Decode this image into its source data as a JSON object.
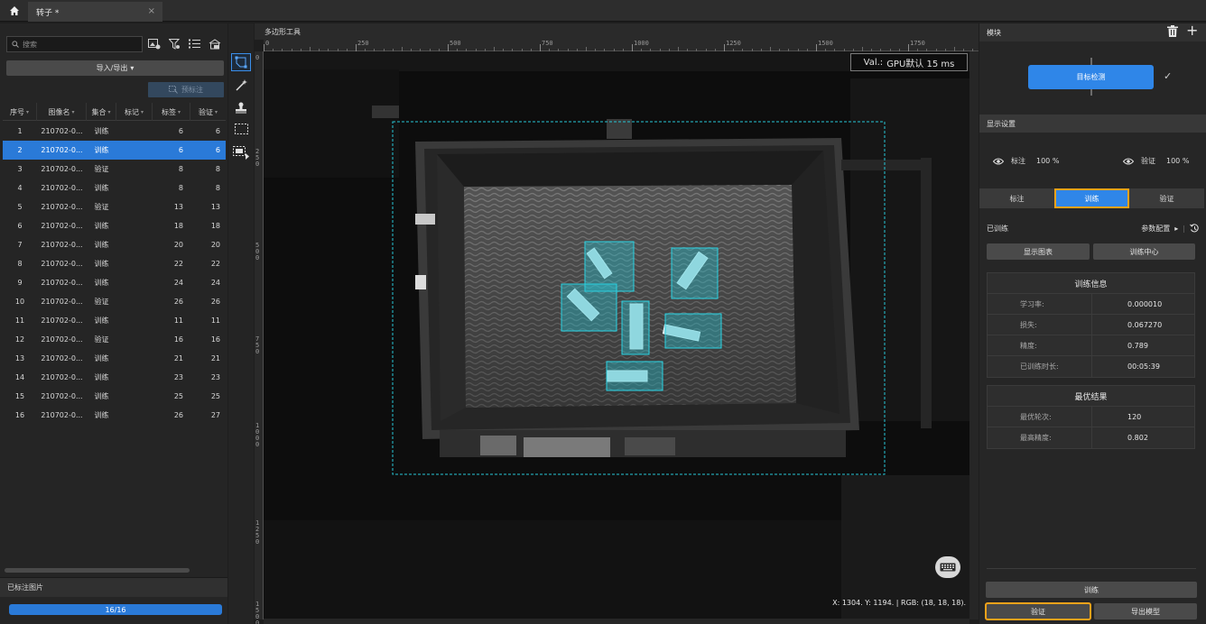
{
  "titlebar": {
    "tab_name": "转子 *",
    "tab_close": "×"
  },
  "left": {
    "search_placeholder": "搜索",
    "io_button": "导入/导出",
    "io_caret": "▾",
    "prelabel_button": "预标注",
    "columns": [
      "序号",
      "图像名",
      "集合",
      "标记",
      "标签",
      "验证"
    ],
    "rows": [
      {
        "idx": "1",
        "name": "210702-0...",
        "set": "训练",
        "label": "6",
        "val": "6",
        "selected": false
      },
      {
        "idx": "2",
        "name": "210702-0...",
        "set": "训练",
        "label": "6",
        "val": "6",
        "selected": true
      },
      {
        "idx": "3",
        "name": "210702-0...",
        "set": "验证",
        "label": "8",
        "val": "8",
        "selected": false
      },
      {
        "idx": "4",
        "name": "210702-0...",
        "set": "训练",
        "label": "8",
        "val": "8",
        "selected": false
      },
      {
        "idx": "5",
        "name": "210702-0...",
        "set": "验证",
        "label": "13",
        "val": "13",
        "selected": false
      },
      {
        "idx": "6",
        "name": "210702-0...",
        "set": "训练",
        "label": "18",
        "val": "18",
        "selected": false
      },
      {
        "idx": "7",
        "name": "210702-0...",
        "set": "训练",
        "label": "20",
        "val": "20",
        "selected": false
      },
      {
        "idx": "8",
        "name": "210702-0...",
        "set": "训练",
        "label": "22",
        "val": "22",
        "selected": false
      },
      {
        "idx": "9",
        "name": "210702-0...",
        "set": "训练",
        "label": "24",
        "val": "24",
        "selected": false
      },
      {
        "idx": "10",
        "name": "210702-0...",
        "set": "验证",
        "label": "26",
        "val": "26",
        "selected": false
      },
      {
        "idx": "11",
        "name": "210702-0...",
        "set": "训练",
        "label": "11",
        "val": "11",
        "selected": false
      },
      {
        "idx": "12",
        "name": "210702-0...",
        "set": "验证",
        "label": "16",
        "val": "16",
        "selected": false
      },
      {
        "idx": "13",
        "name": "210702-0...",
        "set": "训练",
        "label": "21",
        "val": "21",
        "selected": false
      },
      {
        "idx": "14",
        "name": "210702-0...",
        "set": "训练",
        "label": "23",
        "val": "23",
        "selected": false
      },
      {
        "idx": "15",
        "name": "210702-0...",
        "set": "训练",
        "label": "25",
        "val": "25",
        "selected": false
      },
      {
        "idx": "16",
        "name": "210702-0...",
        "set": "训练",
        "label": "26",
        "val": "27",
        "selected": false
      }
    ],
    "footer_label": "已标注图片",
    "progress_text": "16/16",
    "progress_fraction": 1.0
  },
  "canvas": {
    "title": "多边形工具",
    "ruler_top": [
      "0",
      "250",
      "500",
      "750",
      "1000",
      "1250",
      "1500",
      "1750"
    ],
    "ruler_left": [
      "0",
      "250",
      "500",
      "750",
      "1000",
      "1250",
      "1500"
    ],
    "val_label": "Val.:",
    "val_value": "GPU默认 15 ms",
    "coord_readout": "X: 1304. Y: 1194. | RGB: (18, 18, 18)."
  },
  "right": {
    "module_header": "模块",
    "node_label": "目标检测",
    "node_check": "✓",
    "display_header": "显示设置",
    "eye_label_a": "标注",
    "eye_pct_a": "100 %",
    "eye_label_b": "验证",
    "eye_pct_b": "100 %",
    "seg_tabs": [
      "标注",
      "训练",
      "验证"
    ],
    "seg_active": 1,
    "trained_label": "已训练",
    "param_label": "参数配置",
    "param_caret": "▸",
    "param_sep": "|",
    "btn_show_chart": "显示图表",
    "btn_train_center": "训练中心",
    "train_info_title": "训练信息",
    "train_info": [
      {
        "k": "学习率:",
        "v": "0.000010"
      },
      {
        "k": "损失:",
        "v": "0.067270"
      },
      {
        "k": "精度:",
        "v": "0.789"
      },
      {
        "k": "已训练时长:",
        "v": "00:05:39"
      }
    ],
    "best_title": "最优结果",
    "best": [
      {
        "k": "最优轮次:",
        "v": "120"
      },
      {
        "k": "最高精度:",
        "v": "0.802"
      }
    ],
    "btn_train": "训练",
    "btn_validate": "验证",
    "btn_export": "导出模型"
  },
  "colors": {
    "accent": "#2f86e8",
    "highlight": "#f3a21a",
    "annotation": "#27c6d6"
  }
}
